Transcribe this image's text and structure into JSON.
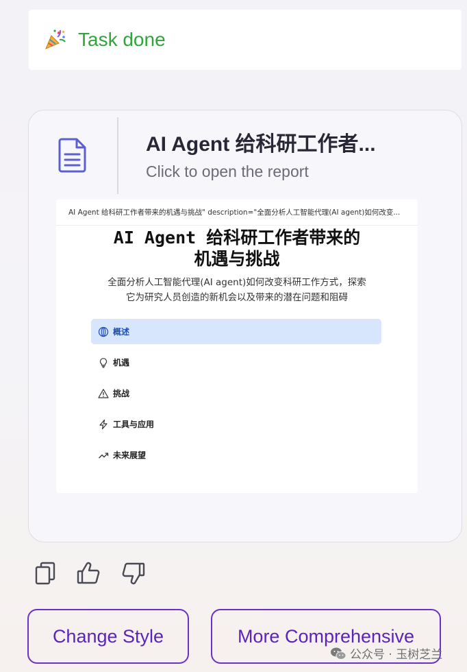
{
  "task": {
    "icon": "party-popper-icon",
    "status_text": "Task done",
    "status_color": "#2fa53a"
  },
  "report": {
    "icon": "document-icon",
    "title": "AI Agent 给科研工作者...",
    "subtitle": "Click to open the report",
    "preview": {
      "top_line": "AI Agent 给科研工作者带来的机遇与挑战\" description=\"全面分析人工智能代理(AI agent)如何改变...",
      "heading_line1": "AI Agent 给科研工作者带来的",
      "heading_line2": "机遇与挑战",
      "desc_line1": "全面分析人工智能代理(AI agent)如何改变科研工作方式，探索",
      "desc_line2": "它为研究人员创造的新机会以及带来的潜在问题和阻碍",
      "nav": [
        {
          "label": "概述",
          "icon": "globe-icon",
          "active": true
        },
        {
          "label": "机遇",
          "icon": "lightbulb-icon",
          "active": false
        },
        {
          "label": "挑战",
          "icon": "warning-icon",
          "active": false
        },
        {
          "label": "工具与应用",
          "icon": "lightning-icon",
          "active": false
        },
        {
          "label": "未来展望",
          "icon": "trending-up-icon",
          "active": false
        }
      ]
    }
  },
  "feedback": {
    "copy_icon": "copy-icon",
    "like_icon": "thumbs-up-icon",
    "dislike_icon": "thumbs-down-icon"
  },
  "actions": {
    "change_style": "Change Style",
    "more_comprehensive": "More Comprehensive",
    "accent_color": "#6a31c8"
  },
  "watermark": {
    "icon": "wechat-icon",
    "text": "公众号 · 玉树芝兰"
  }
}
